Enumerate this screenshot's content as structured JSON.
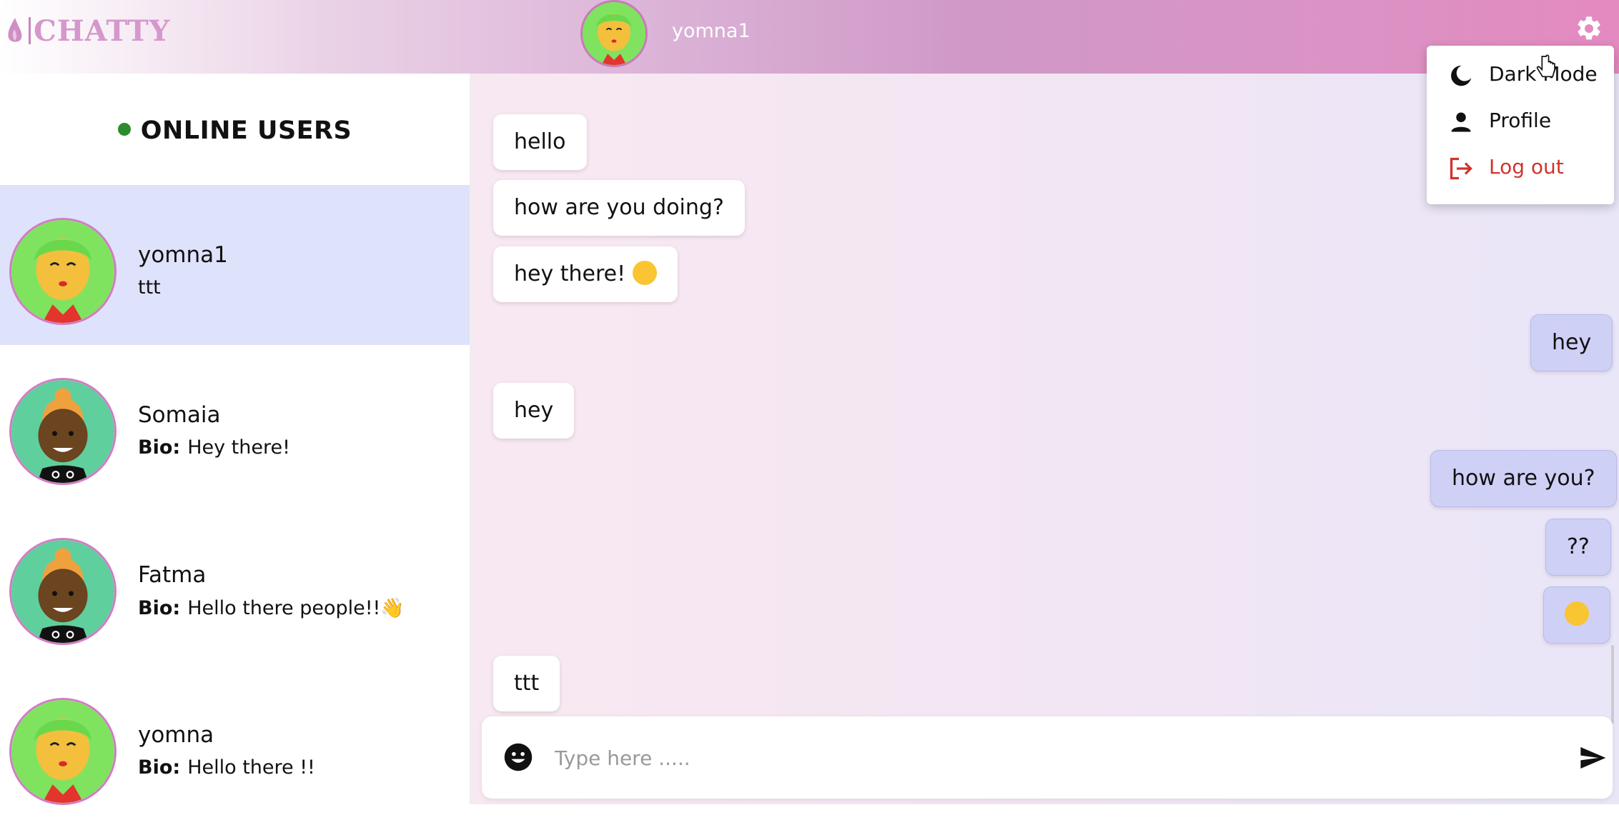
{
  "app": {
    "logo_text": "CHATTY"
  },
  "header": {
    "current_user": "yomna1"
  },
  "sidebar": {
    "title": "ONLINE USERS",
    "bio_label": "Bio:",
    "users": [
      {
        "name": "yomna1",
        "subtitle": "ttt",
        "active": true
      },
      {
        "name": "Somaia",
        "bio": "Hey there!"
      },
      {
        "name": "Fatma",
        "bio": "Hello there people!!👋"
      },
      {
        "name": "yomna",
        "bio": "Hello there !!"
      }
    ]
  },
  "chat": {
    "messages": [
      {
        "direction": "in",
        "text": "hello"
      },
      {
        "direction": "in",
        "text": "how are you doing?"
      },
      {
        "direction": "in",
        "text": "hey there!",
        "emoji": "😂"
      },
      {
        "direction": "out",
        "text": "hey"
      },
      {
        "direction": "in",
        "text": "hey"
      },
      {
        "direction": "out",
        "text": "how are you?"
      },
      {
        "direction": "out",
        "text": "??"
      },
      {
        "direction": "out",
        "text": "",
        "emoji": "😂"
      },
      {
        "direction": "in",
        "text": "ttt"
      }
    ],
    "input_placeholder": "Type here ....."
  },
  "menu": {
    "items": [
      {
        "label": "Dark Mode",
        "icon": "moon-icon"
      },
      {
        "label": "Profile",
        "icon": "person-icon"
      },
      {
        "label": "Log out",
        "icon": "logout-icon"
      }
    ]
  },
  "colors": {
    "accent_pink": "#e48ac0",
    "active_user_bg": "#dfe2fb",
    "outgoing_bubble": "#cfd0f6",
    "logout_red": "#d0342c",
    "online_dot": "#2e8b2e"
  }
}
